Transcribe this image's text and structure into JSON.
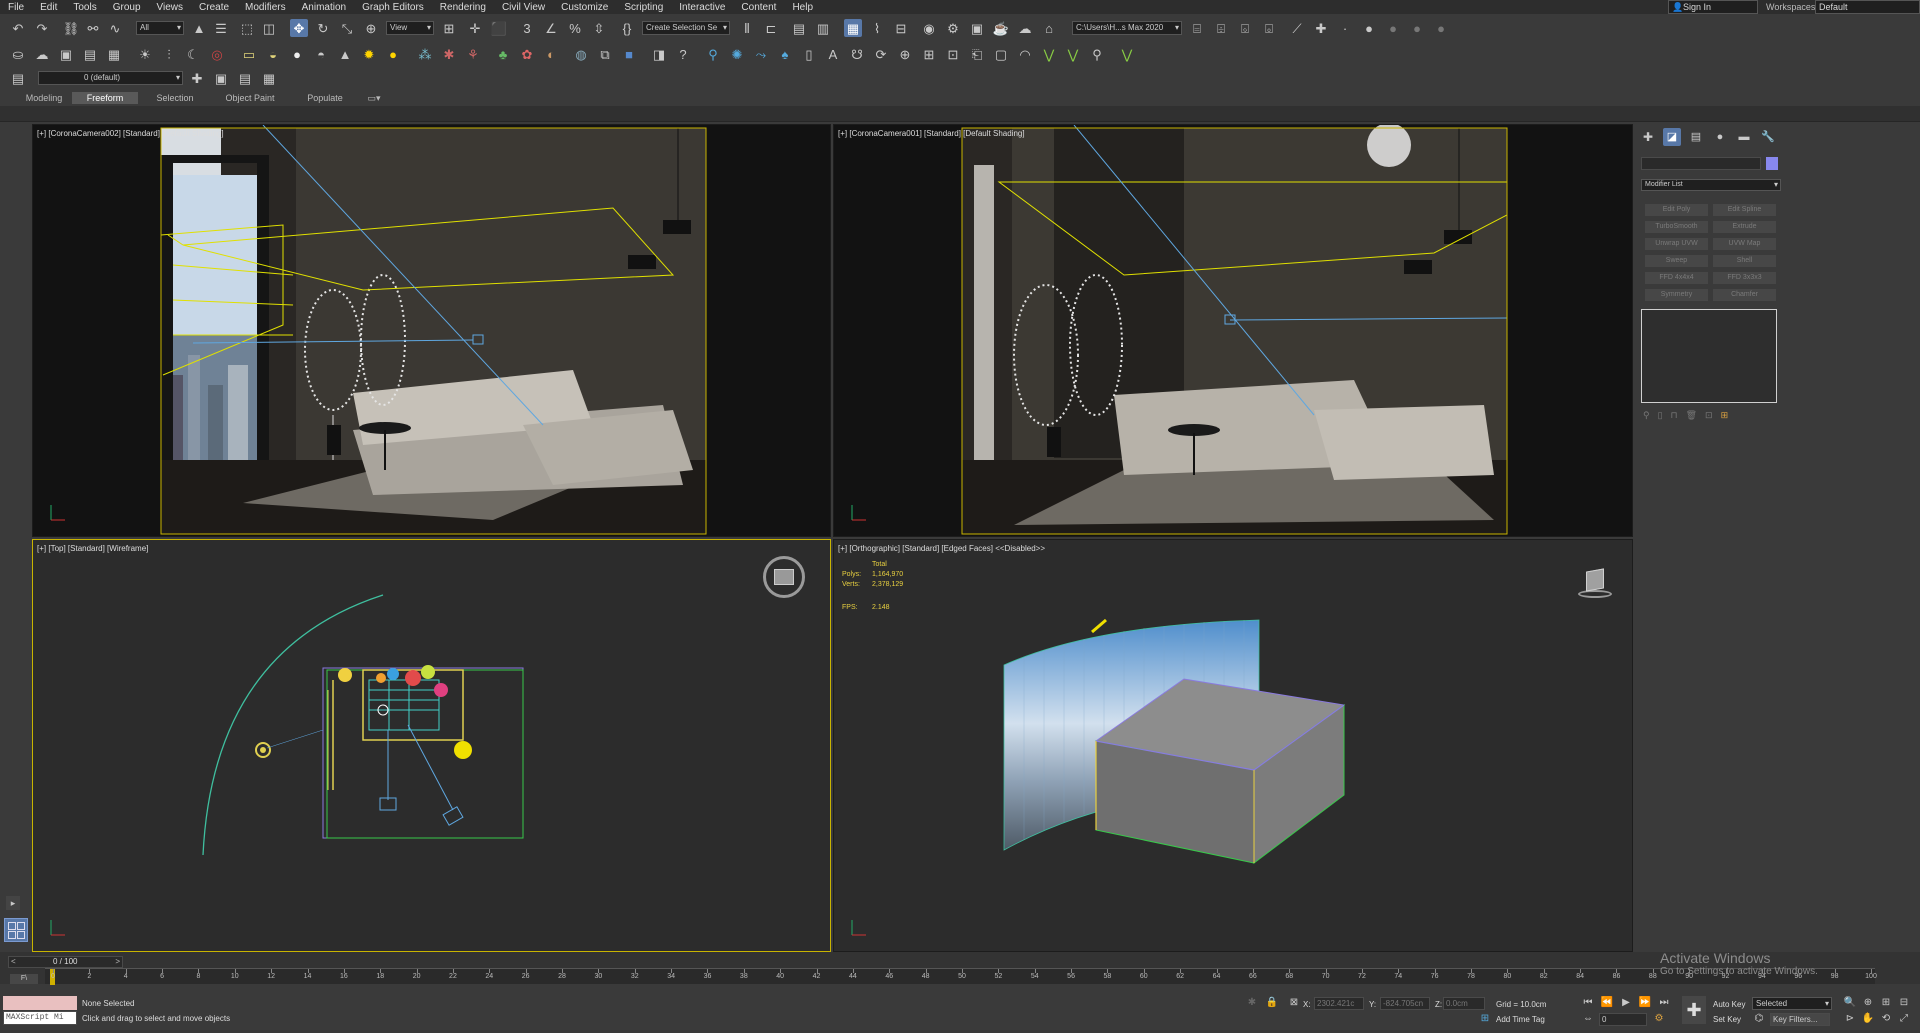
{
  "menu": [
    "File",
    "Edit",
    "Tools",
    "Group",
    "Views",
    "Create",
    "Modifiers",
    "Animation",
    "Graph Editors",
    "Rendering",
    "Civil View",
    "Customize",
    "Scripting",
    "Interactive",
    "Content",
    "Help"
  ],
  "header": {
    "sign_in": "Sign In",
    "workspace_label": "Workspaces:",
    "workspace_value": "Default"
  },
  "toolbar": {
    "selection_filter": "All",
    "reference_coord": "View",
    "named_selection": "Create Selection Se",
    "project_path": "C:\\Users\\H...s Max 2020",
    "layer": "0 (default)"
  },
  "ribbon_tabs": [
    "Modeling",
    "Freeform",
    "Selection",
    "Object Paint",
    "Populate"
  ],
  "viewports": {
    "top_left": {
      "label": "[+] [CoronaCamera002] [Standard] [Default Shading]"
    },
    "top_right": {
      "label": "[+] [CoronaCamera001] [Standard] [Default Shading]"
    },
    "bottom_left": {
      "label": "[+] [Top] [Standard] [Wireframe]"
    },
    "bottom_right": {
      "label": "[+] [Orthographic] [Standard] [Edged Faces]  <<Disabled>>"
    }
  },
  "stats": {
    "total": "Total",
    "polys_label": "Polys:",
    "polys": "1,164,970",
    "verts_label": "Verts:",
    "verts": "2,378,129",
    "fps_label": "FPS:",
    "fps": "2.148"
  },
  "command_panel": {
    "modifier_list": "Modifier List",
    "buttons": [
      "Edit Poly",
      "Edit Spline",
      "TurboSmooth",
      "Extrude",
      "Unwrap UVW",
      "UVW Map",
      "Sweep",
      "Shell",
      "FFD 4x4x4",
      "FFD 3x3x3",
      "Symmetry",
      "Chamfer"
    ]
  },
  "timeline": {
    "frame": "0 / 100",
    "ticks": [
      "0",
      "2",
      "4",
      "6",
      "8",
      "10",
      "12",
      "14",
      "16",
      "18",
      "20",
      "22",
      "24",
      "26",
      "28",
      "30",
      "32",
      "34",
      "36",
      "38",
      "40",
      "42",
      "44",
      "46",
      "48",
      "50",
      "52",
      "54",
      "56",
      "58",
      "60",
      "62",
      "64",
      "66",
      "68",
      "70",
      "72",
      "74",
      "76",
      "78",
      "80",
      "82",
      "84",
      "86",
      "88",
      "90",
      "92",
      "94",
      "96",
      "98",
      "100"
    ]
  },
  "status": {
    "maxscript": "MAXScript Mi",
    "selection": "None Selected",
    "prompt": "Click and drag to select and move objects",
    "x_label": "X:",
    "x_value": "2302.421c",
    "y_label": "Y:",
    "y_value": "-824.705cn",
    "z_label": "Z:",
    "z_value": "0.0cm",
    "grid": "Grid = 10.0cm",
    "add_time_tag": "Add Time Tag",
    "auto_key": "Auto Key",
    "set_key": "Set Key",
    "key_mode": "Selected",
    "key_filters": "Key Filters...",
    "current_frame": "0"
  },
  "watermark": {
    "title": "Activate Windows",
    "subtitle": "Go to Settings to activate Windows."
  }
}
